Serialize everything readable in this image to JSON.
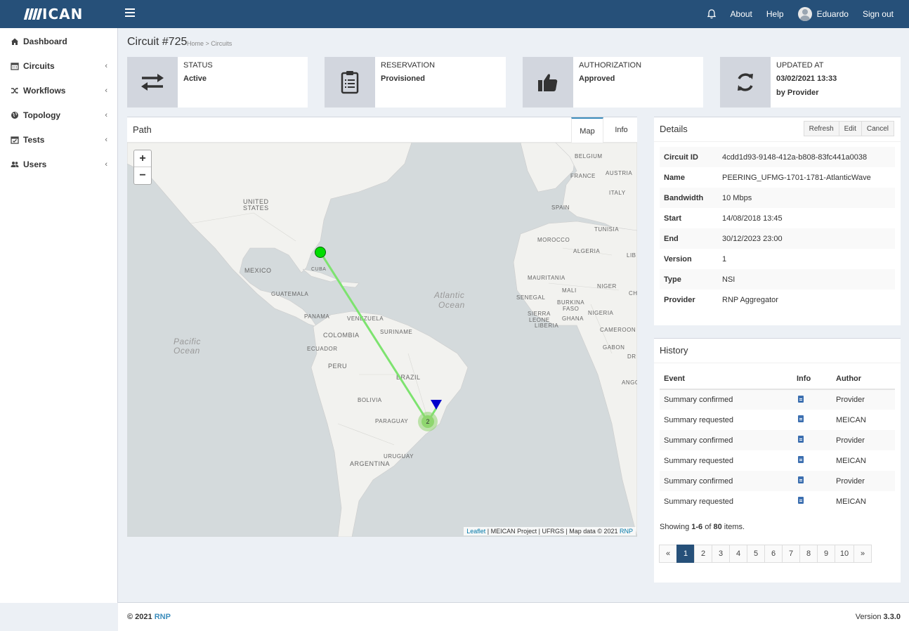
{
  "app": {
    "logo_text": "ICAN"
  },
  "topbar": {
    "about": "About",
    "help": "Help",
    "user": "Eduardo",
    "signout": "Sign out",
    "icons": [
      "bell-icon",
      "avatar",
      "hamburger-icon"
    ]
  },
  "sidebar": {
    "items": [
      {
        "label": "Dashboard",
        "icon": "home-icon"
      },
      {
        "label": "Circuits",
        "icon": "calendar-icon",
        "chevron": "‹"
      },
      {
        "label": "Workflows",
        "icon": "shuffle-icon",
        "chevron": "‹"
      },
      {
        "label": "Topology",
        "icon": "globe-icon",
        "chevron": "‹"
      },
      {
        "label": "Tests",
        "icon": "calendar-check-icon",
        "chevron": "‹"
      },
      {
        "label": "Users",
        "icon": "users-icon",
        "chevron": "‹"
      }
    ]
  },
  "page": {
    "title": "Circuit #725",
    "breadcrumb": "Home > Circuits"
  },
  "infoboxes": [
    {
      "label": "STATUS",
      "value": "Active",
      "icon": "exchange-icon"
    },
    {
      "label": "RESERVATION",
      "value": "Provisioned",
      "icon": "clipboard-icon"
    },
    {
      "label": "AUTHORIZATION",
      "value": "Approved",
      "icon": "thumbs-up-icon"
    },
    {
      "label": "UPDATED AT",
      "value": "03/02/2021 13:33",
      "value2": "by Provider",
      "icon": "refresh-icon"
    }
  ],
  "path": {
    "title": "Path",
    "tabs": [
      "Map",
      "Info"
    ],
    "active_tab": "Map",
    "zoom_in": "+",
    "zoom_out": "−",
    "cluster_count": "2",
    "map_labels": {
      "us": [
        "UNITED",
        "STATES"
      ],
      "mexico": "MEXICO",
      "cuba": "CUBA",
      "guatemala": "GUATEMALA",
      "panama": "PANAMA",
      "venezuela": "VENEZUELA",
      "colombia": "COLOMBIA",
      "suriname": "SURINAME",
      "ecuador": "ECUADOR",
      "peru": "PERU",
      "brazil": "BRAZIL",
      "bolivia": "BOLIVIA",
      "paraguay": "PARAGUAY",
      "uruguay": "URUGUAY",
      "argentina": "ARGENTINA",
      "pacific": [
        "Pacific",
        "Ocean"
      ],
      "atlantic": [
        "Atlantic",
        "Ocean"
      ],
      "belgium": "BELGIUM",
      "france": "FRANCE",
      "austria": "AUSTRIA",
      "italy": "ITALY",
      "spain": "SPAIN",
      "tunisia": "TUNISIA",
      "morocco": "MOROCCO",
      "algeria": "ALGERIA",
      "lib": "LIB",
      "mauritania": "MAURITANIA",
      "mali": "MALI",
      "niger": "NIGER",
      "ch": "CH",
      "senegal": "SENEGAL",
      "burkina": [
        "BURKINA",
        "FASO"
      ],
      "sierra": [
        "SIERRA",
        "LEONE"
      ],
      "liberia": "LIBERIA",
      "ghana": "GHANA",
      "nigeria": "NIGERIA",
      "cameroon": "CAMEROON",
      "gabon": "GABON",
      "drc": "DR",
      "ango": "ANGO"
    },
    "attribution": {
      "leaflet": "Leaflet",
      "text": " | MEICAN Project | UFRGS | Map data © 2021 ",
      "rnp": "RNP"
    },
    "colors": {
      "path_line": "#7de36f",
      "source_marker": "#00dd00",
      "dest_marker": "#0000cc",
      "cluster": "#8fd66f"
    }
  },
  "details": {
    "title": "Details",
    "buttons": [
      "Refresh",
      "Edit",
      "Cancel"
    ],
    "rows": [
      {
        "key": "Circuit ID",
        "value": "4cdd1d93-9148-412a-b808-83fc441a0038"
      },
      {
        "key": "Name",
        "value": "PEERING_UFMG-1701-1781-AtlanticWave"
      },
      {
        "key": "Bandwidth",
        "value": "10 Mbps"
      },
      {
        "key": "Start",
        "value": "14/08/2018 13:45"
      },
      {
        "key": "End",
        "value": "30/12/2023 23:00"
      },
      {
        "key": "Version",
        "value": "1"
      },
      {
        "key": "Type",
        "value": "NSI"
      },
      {
        "key": "Provider",
        "value": "RNP Aggregator"
      }
    ]
  },
  "history": {
    "title": "History",
    "columns": [
      "Event",
      "Info",
      "Author"
    ],
    "rows": [
      {
        "event": "Summary confirmed",
        "author": "Provider"
      },
      {
        "event": "Summary requested",
        "author": "MEICAN"
      },
      {
        "event": "Summary confirmed",
        "author": "Provider"
      },
      {
        "event": "Summary requested",
        "author": "MEICAN"
      },
      {
        "event": "Summary confirmed",
        "author": "Provider"
      },
      {
        "event": "Summary requested",
        "author": "MEICAN"
      }
    ],
    "summary": {
      "prefix": "Showing ",
      "range": "1-6",
      "mid": " of ",
      "total": "80",
      "suffix": " items."
    },
    "pages": [
      "«",
      "1",
      "2",
      "3",
      "4",
      "5",
      "6",
      "7",
      "8",
      "9",
      "10",
      "»"
    ],
    "active_page": "1"
  },
  "footer": {
    "copyright": "© 2021 ",
    "org": "RNP",
    "version_label": "Version ",
    "version": "3.3.0"
  }
}
